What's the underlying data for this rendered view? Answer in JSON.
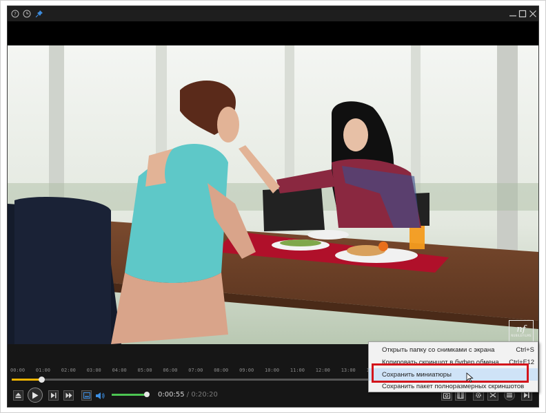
{
  "window": {
    "title_icons": [
      "help-icon",
      "history-icon",
      "pin-icon"
    ],
    "window_buttons": [
      "minimize-icon",
      "maximize-icon",
      "close-icon"
    ]
  },
  "watermark": {
    "logo": "nf",
    "text": "NUBILEFILMS"
  },
  "timeline": {
    "ticks": [
      "00:00",
      "01:00",
      "02:00",
      "03:00",
      "04:00",
      "05:00",
      "06:00",
      "07:00",
      "08:00",
      "09:00",
      "10:00",
      "11:00",
      "12:00",
      "13:00",
      "14:00"
    ],
    "progress_fraction": 0.083
  },
  "playback": {
    "current_time": "0:00:55",
    "separator": "/",
    "duration": "0:20:20",
    "volume_fraction": 0.98
  },
  "context_menu": {
    "items": [
      {
        "label": "Открыть папку со снимками с экрана",
        "shortcut": "Ctrl+S"
      },
      {
        "label": "Копировать скриншот в буфер обмена",
        "shortcut": "Ctrl+F12"
      },
      {
        "label": "Сохранить миниатюры",
        "shortcut": ""
      },
      {
        "label": "Сохранить пакет полноразмерных скриншотов",
        "shortcut": ""
      }
    ],
    "highlighted_index": 2
  },
  "colors": {
    "accent_seek": "#f0b400",
    "accent_volume": "#4cc552",
    "highlight_box": "#d3141b"
  }
}
